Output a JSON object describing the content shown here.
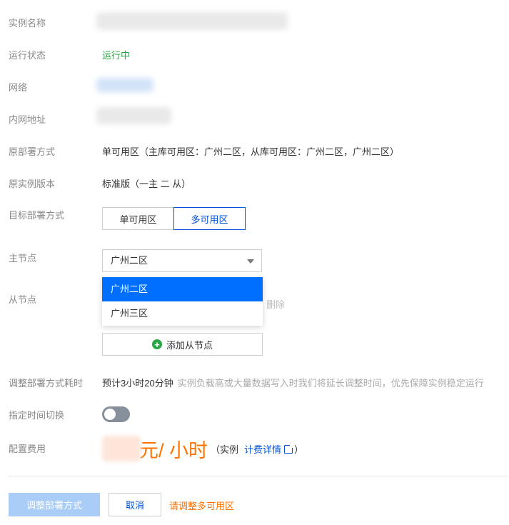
{
  "labels": {
    "instance_name": "实例名称",
    "status": "运行状态",
    "network": "网络",
    "private_ip": "内网地址",
    "orig_deploy": "原部署方式",
    "orig_version": "原实例版本",
    "target_deploy": "目标部署方式",
    "master_node": "主节点",
    "slave_node": "从节点",
    "adjust_time": "调整部署方式耗时",
    "scheduled_switch": "指定时间切换",
    "config_fee": "配置费用"
  },
  "values": {
    "status": "运行中",
    "orig_deploy": "单可用区（主库可用区：广州二区，从库可用区：广州二区，广州二区）",
    "orig_version": "标准版（一主 二 从）",
    "adjust_time_estimate": "预计3小时20分钟",
    "adjust_time_hint": "实例负载高或大量数据写入时我们将延长调整时间，优先保障实例稳定运行"
  },
  "target_deploy_options": [
    "单可用区",
    "多可用区"
  ],
  "target_deploy_selected": "多可用区",
  "master_select": {
    "value": "广州二区",
    "options": [
      "广州二区",
      "广州三区"
    ],
    "highlighted": "广州二区"
  },
  "slave": {
    "delete_label": "删除",
    "add_label": "添加从节点"
  },
  "toggle": {
    "on": false
  },
  "price": {
    "unit": "元/ 小时",
    "suffix": "（实例",
    "link": "计费详情",
    "close": "）"
  },
  "footer": {
    "submit": "调整部署方式",
    "cancel": "取消",
    "warning": "请调整多可用区"
  },
  "colors": {
    "accent": "#0052d9",
    "success": "#29a745",
    "price": "#ff7200",
    "highlight": "#006eff"
  }
}
